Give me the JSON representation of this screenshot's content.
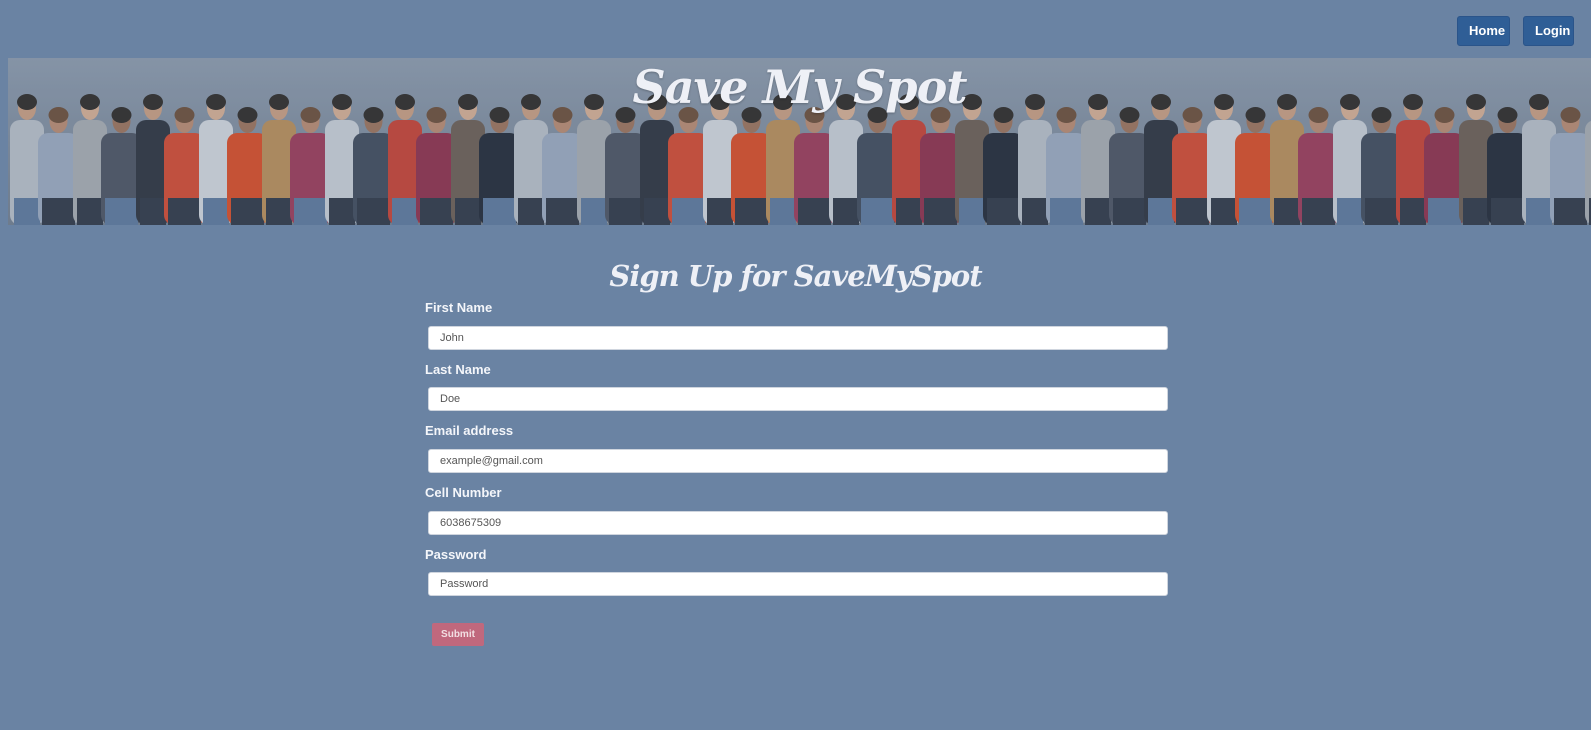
{
  "nav": {
    "home_label": "Home",
    "login_label": "Login",
    "button_color": "#2f5e96"
  },
  "banner": {
    "title": "Save My Spot"
  },
  "form": {
    "title": "Sign Up for SaveMySpot",
    "fields": [
      {
        "label": "First Name",
        "placeholder": "John"
      },
      {
        "label": "Last Name",
        "placeholder": "Doe"
      },
      {
        "label": "Email address",
        "placeholder": "example@gmail.com"
      },
      {
        "label": "Cell Number",
        "placeholder": "6038675309"
      },
      {
        "label": "Password",
        "placeholder": "Password"
      }
    ],
    "submit_label": "Submit",
    "submit_color": "#c0687d"
  },
  "colors": {
    "background": "#6a83a3"
  }
}
